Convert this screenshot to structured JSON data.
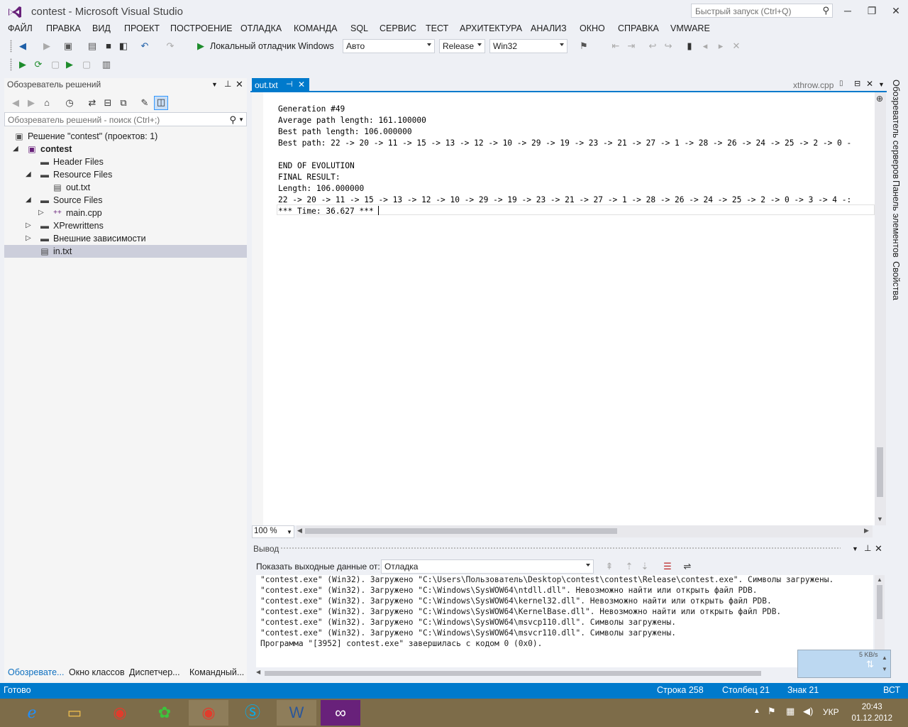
{
  "window": {
    "title": "contest - Microsoft Visual Studio",
    "quick_launch_placeholder": "Быстрый запуск (Ctrl+Q)"
  },
  "menu": [
    "ФАЙЛ",
    "ПРАВКА",
    "ВИД",
    "ПРОЕКТ",
    "ПОСТРОЕНИЕ",
    "ОТЛАДКА",
    "КОМАНДА",
    "SQL",
    "СЕРВИС",
    "ТЕСТ",
    "АРХИТЕКТУРА",
    "АНАЛИЗ",
    "ОКНО",
    "СПРАВКА",
    "VMWARE"
  ],
  "toolbar": {
    "debugger_label": "Локальный отладчик Windows",
    "mode": "Авто",
    "configuration": "Release",
    "platform": "Win32"
  },
  "solution_explorer": {
    "title": "Обозреватель решений",
    "search_placeholder": "Обозреватель решений - поиск (Ctrl+;)",
    "tree": [
      {
        "label": "Решение \"contest\"  (проектов: 1)",
        "icon": "solution-icon"
      },
      {
        "label": "contest",
        "icon": "project-icon"
      },
      {
        "label": "Header Files",
        "icon": "folder-icon"
      },
      {
        "label": "Resource Files",
        "icon": "folder-icon"
      },
      {
        "label": "out.txt",
        "icon": "text-file-icon"
      },
      {
        "label": "Source Files",
        "icon": "folder-icon"
      },
      {
        "label": "main.cpp",
        "icon": "cpp-file-icon"
      },
      {
        "label": "XPrewrittens",
        "icon": "folder-icon"
      },
      {
        "label": "Внешние зависимости",
        "icon": "folder-icon"
      },
      {
        "label": "in.txt",
        "icon": "text-file-icon"
      }
    ],
    "bottom_tabs": [
      "Обозревате...",
      "Окно классов",
      "Диспетчер...",
      "Командный..."
    ]
  },
  "editor": {
    "active_tab": "out.txt",
    "right_tab": "xthrow.cpp",
    "lines": [
      "Generation #49",
      "Average path length: 161.100000",
      "Best path length: 106.000000",
      "Best path: 22 -> 20 -> 11 -> 15 -> 13 -> 12 -> 10 -> 29 -> 19 -> 23 -> 21 -> 27 -> 1 -> 28 -> 26 -> 24 -> 25 -> 2 -> 0 -",
      "",
      "END OF EVOLUTION",
      "FINAL RESULT:",
      "Length: 106.000000",
      "22 -> 20 -> 11 -> 15 -> 13 -> 12 -> 10 -> 29 -> 19 -> 23 -> 21 -> 27 -> 1 -> 28 -> 26 -> 24 -> 25 -> 2 -> 0 -> 3 -> 4 -:",
      "*** Time: 36.627 ***"
    ],
    "zoom": "100 %"
  },
  "side_tabs": [
    "Обозреватель серверов",
    "Панель элементов",
    "Свойства"
  ],
  "output": {
    "title": "Вывод",
    "show_label": "Показать выходные данные от:",
    "source": "Отладка",
    "lines": [
      "\"contest.exe\" (Win32). Загружено \"C:\\Users\\Пользователь\\Desktop\\contest\\contest\\Release\\contest.exe\". Символы загружены.",
      "\"contest.exe\" (Win32). Загружено \"C:\\Windows\\SysWOW64\\ntdll.dll\". Невозможно найти или открыть файл PDB.",
      "\"contest.exe\" (Win32). Загружено \"C:\\Windows\\SysWOW64\\kernel32.dll\". Невозможно найти или открыть файл PDB.",
      "\"contest.exe\" (Win32). Загружено \"C:\\Windows\\SysWOW64\\KernelBase.dll\". Невозможно найти или открыть файл PDB.",
      "\"contest.exe\" (Win32). Загружено \"C:\\Windows\\SysWOW64\\msvcp110.dll\". Символы загружены.",
      "\"contest.exe\" (Win32). Загружено \"C:\\Windows\\SysWOW64\\msvcr110.dll\". Символы загружены.",
      "Программа \"[3952] contest.exe\" завершилась с кодом 0 (0x0)."
    ]
  },
  "net_widget": {
    "speed": "5 KB/s"
  },
  "status": {
    "ready": "Готово",
    "line": "Строка 258",
    "column": "Столбец 21",
    "char": "Знак 21",
    "mode": "ВСТ"
  },
  "taskbar": {
    "apps": [
      "internet-explorer-icon",
      "file-explorer-icon",
      "chrome-icon",
      "icq-icon",
      "chrome-icon",
      "skype-icon",
      "word-icon",
      "visual-studio-icon"
    ],
    "lang": "УКР",
    "time": "20:43",
    "date": "01.12.2012"
  },
  "colors": {
    "accent": "#007acc",
    "vs_purple": "#68217a",
    "taskbar": "#7d6c49"
  }
}
